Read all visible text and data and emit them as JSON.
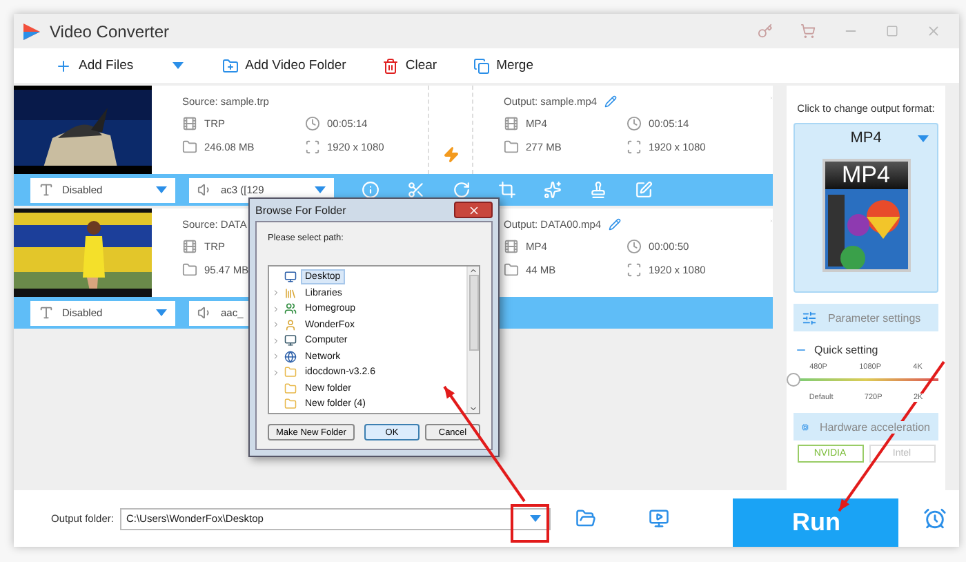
{
  "window": {
    "title": "Video Converter"
  },
  "toolbar": [
    {
      "kind": "add",
      "label": "Add Files"
    },
    {
      "kind": "folder",
      "label": "Add Video Folder"
    },
    {
      "kind": "clear",
      "label": "Clear"
    },
    {
      "kind": "merge",
      "label": "Merge"
    }
  ],
  "files": [
    {
      "source": "Source: sample.trp",
      "src_format": "TRP",
      "src_duration": "00:05:14",
      "src_size": "246.08 MB",
      "src_resolution": "1920 x 1080",
      "output": "Output: sample.mp4",
      "out_format": "MP4",
      "out_duration": "00:05:14",
      "out_size": "277 MB",
      "out_resolution": "1920 x 1080",
      "subtitle": "Disabled",
      "audio": "ac3 ([129",
      "tools": [
        {
          "kind": "info"
        },
        {
          "kind": "cut"
        },
        {
          "kind": "rotate"
        },
        {
          "kind": "crop"
        },
        {
          "kind": "effect"
        },
        {
          "kind": "watermark"
        },
        {
          "kind": "edit"
        }
      ]
    },
    {
      "source": "Source: DATA",
      "src_format": "TRP",
      "src_size": "95.47 MB",
      "output": "Output: DATA00.mp4",
      "out_format": "MP4",
      "out_duration": "00:00:50",
      "out_size": "44 MB",
      "out_resolution": "1920 x 1080",
      "subtitle": "Disabled",
      "audio": "aac_"
    }
  ],
  "output_panel": {
    "hint": "Click to change output format:",
    "format": "MP4",
    "format_icon_label": "MP4",
    "parameter_button": "Parameter settings",
    "quick_setting": "Quick setting",
    "quality_top": [
      "480P",
      "1080P",
      "4K"
    ],
    "quality_bottom": [
      "Default",
      "720P",
      "2K"
    ],
    "quality": {
      "level": 0
    },
    "hardware_button": "Hardware acceleration",
    "gpus": [
      {
        "label": "NVIDIA",
        "selected": true
      },
      {
        "label": "Intel",
        "selected": false
      }
    ]
  },
  "bottom": {
    "label": "Output folder:",
    "path": "C:\\Users\\WonderFox\\Desktop",
    "run": "Run"
  },
  "dialog": {
    "title": "Browse For Folder",
    "prompt": "Please select path:",
    "tree": [
      {
        "label": "Desktop",
        "kind": "desktop",
        "selected": true,
        "expandable": false
      },
      {
        "label": "Libraries",
        "kind": "library",
        "selected": false,
        "expandable": true
      },
      {
        "label": "Homegroup",
        "kind": "homegroup",
        "selected": false,
        "expandable": true
      },
      {
        "label": "WonderFox",
        "kind": "user",
        "selected": false,
        "expandable": true
      },
      {
        "label": "Computer",
        "kind": "computer",
        "selected": false,
        "expandable": true
      },
      {
        "label": "Network",
        "kind": "network",
        "selected": false,
        "expandable": true
      },
      {
        "label": "idocdown-v3.2.6",
        "kind": "folder",
        "selected": false,
        "expandable": true
      },
      {
        "label": "New folder",
        "kind": "folder",
        "selected": false,
        "expandable": false
      },
      {
        "label": "New folder (4)",
        "kind": "folder",
        "selected": false,
        "expandable": false
      }
    ],
    "buttons": [
      {
        "label": "Make New Folder",
        "default": false
      },
      {
        "label": "OK",
        "default": true
      },
      {
        "label": "Cancel",
        "default": false
      }
    ]
  }
}
